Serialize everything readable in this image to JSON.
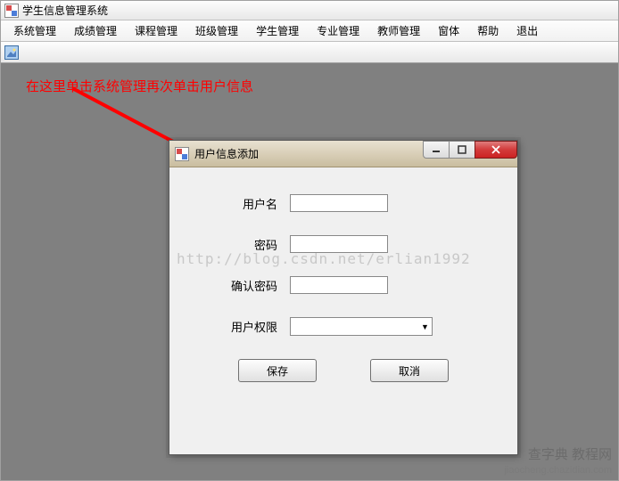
{
  "main_window": {
    "title": "学生信息管理系统"
  },
  "menu": {
    "items": [
      "系统管理",
      "成绩管理",
      "课程管理",
      "班级管理",
      "学生管理",
      "专业管理",
      "教师管理",
      "窗体",
      "帮助",
      "退出"
    ]
  },
  "annotation": {
    "text": "在这里单击系统管理再次单击用户信息"
  },
  "child_window": {
    "title": "用户信息添加",
    "fields": {
      "username_label": "用户名",
      "username_value": "",
      "password_label": "密码",
      "password_value": "",
      "confirm_label": "确认密码",
      "confirm_value": "",
      "role_label": "用户权限",
      "role_value": ""
    },
    "buttons": {
      "save": "保存",
      "cancel": "取消"
    }
  },
  "watermark": "http://blog.csdn.net/erlian1992",
  "footer": {
    "line1": "查字典 教程网",
    "line2": "jiaocheng.chazidian.com"
  }
}
